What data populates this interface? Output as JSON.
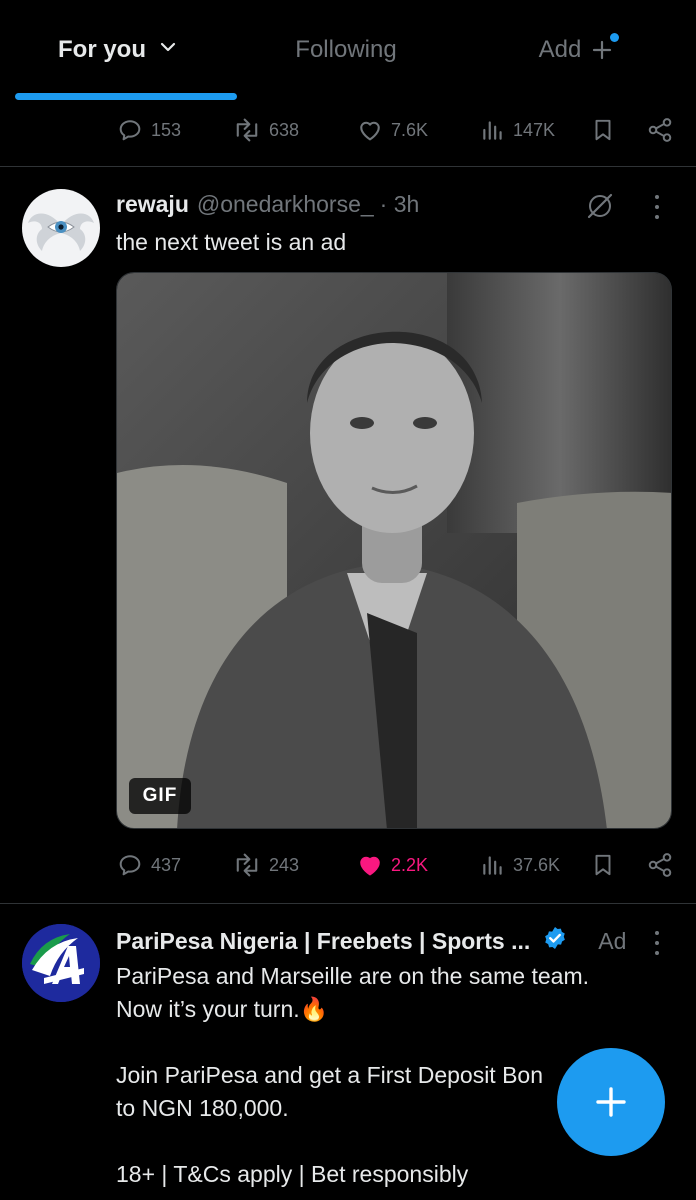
{
  "tabs": {
    "for_you": "For you",
    "following": "Following",
    "add": "Add"
  },
  "prev_tweet_actions": {
    "replies": "153",
    "reposts": "638",
    "likes": "7.6K",
    "views": "147K"
  },
  "tweet1": {
    "name": "rewaju",
    "handle": "@onedarkhorse_",
    "time": "· 3h",
    "text": "the next tweet is an ad",
    "media_badge": "GIF",
    "actions": {
      "replies": "437",
      "reposts": "243",
      "likes": "2.2K",
      "views": "37.6K",
      "liked": true
    }
  },
  "tweet2": {
    "name": "PariPesa Nigeria | Freebets | Sports ...",
    "ad_label": "Ad",
    "text_line1": "PariPesa and Marseille are on the same team.",
    "text_line2": "Now it’s your turn.🔥",
    "text_line3": "Join PariPesa and get a First Deposit Bon",
    "text_line4": "to NGN 180,000.",
    "text_line5": "18+ | T&Cs apply | Bet responsibly"
  },
  "colors": {
    "accent": "#1d9bf0",
    "like": "#f91880",
    "muted": "#71767b",
    "text": "#e7e9ea",
    "background": "#000000"
  },
  "icons": [
    "chevron-down-icon",
    "plus-icon",
    "reply-icon",
    "repost-icon",
    "heart-icon",
    "views-icon",
    "bookmark-icon",
    "share-icon",
    "grok-icon",
    "more-icon",
    "verified-icon",
    "compose-icon"
  ]
}
